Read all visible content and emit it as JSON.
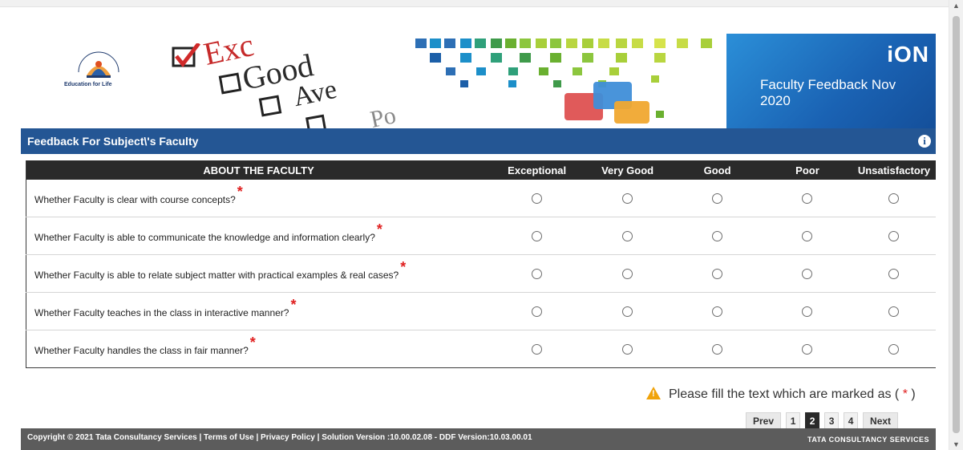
{
  "banner": {
    "logo_text": "Education for Life",
    "image_words": [
      "Exc",
      "Good",
      "Ave",
      "Po"
    ],
    "brand": "iON",
    "title": "Faculty Feedback Nov 2020"
  },
  "section": {
    "title": "Feedback For Subject\\'s Faculty",
    "info_icon": "i"
  },
  "table": {
    "header_question": "ABOUT THE FACULTY",
    "ratings": [
      "Exceptional",
      "Very Good",
      "Good",
      "Poor",
      "Unsatisfactory"
    ],
    "required_mark": "*",
    "questions": [
      "Whether Faculty is clear with course concepts?",
      "Whether Faculty is able to communicate the knowledge and information clearly?",
      "Whether Faculty is able to relate subject matter with practical examples & real cases?",
      "Whether Faculty teaches in the class in interactive manner?",
      "Whether Faculty handles the class in fair manner?"
    ]
  },
  "warning": {
    "text": "Please fill the text which are marked as (",
    "mark": "*",
    "close": ")"
  },
  "pager": {
    "prev": "Prev",
    "pages": [
      "1",
      "2",
      "3",
      "4"
    ],
    "current": "2",
    "next": "Next"
  },
  "footer": {
    "copyright": "Copyright © 2021 Tata Consultancy Services | Terms of Use | Privacy Policy | Solution Version :10.00.02.08 - DDF Version:10.03.00.01",
    "company": "TATA CONSULTANCY SERVICES"
  },
  "colors": {
    "section_bar": "#245694",
    "header_bg": "#2a2a2a",
    "footer_bg": "#5c5c5c",
    "required": "#e02020",
    "warning": "#f0a30a",
    "ion_panel": "#1a62b3"
  }
}
